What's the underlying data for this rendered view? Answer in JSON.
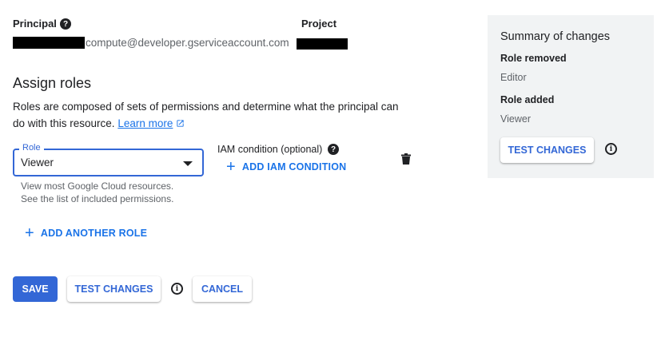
{
  "principal": {
    "label": "Principal",
    "email_suffix": "compute@developer.gserviceaccount.com"
  },
  "project": {
    "label": "Project"
  },
  "assign": {
    "title": "Assign roles",
    "description": "Roles are composed of sets of permissions and determine what the principal can do with this resource.",
    "learn_more": "Learn more"
  },
  "role_field": {
    "legend": "Role",
    "value": "Viewer",
    "hint_line1": "View most Google Cloud resources.",
    "hint_line2": "See the list of included permissions."
  },
  "iam_condition": {
    "label": "IAM condition (optional)",
    "add_label": "ADD IAM CONDITION"
  },
  "add_another_role": "ADD ANOTHER ROLE",
  "actions": {
    "save": "SAVE",
    "test_changes": "TEST CHANGES",
    "cancel": "CANCEL"
  },
  "summary": {
    "title": "Summary of changes",
    "role_removed_label": "Role removed",
    "role_removed_value": "Editor",
    "role_added_label": "Role added",
    "role_added_value": "Viewer",
    "test_changes": "TEST CHANGES"
  },
  "icons": {
    "help": "help-icon",
    "info": "info-icon",
    "delete": "trash-icon",
    "external": "external-link-icon",
    "dropdown": "caret-down-icon",
    "add": "plus-icon"
  },
  "colors": {
    "accent": "#1a73e8",
    "primary_button": "#3367d6",
    "summary_bg": "#f1f3f4"
  }
}
